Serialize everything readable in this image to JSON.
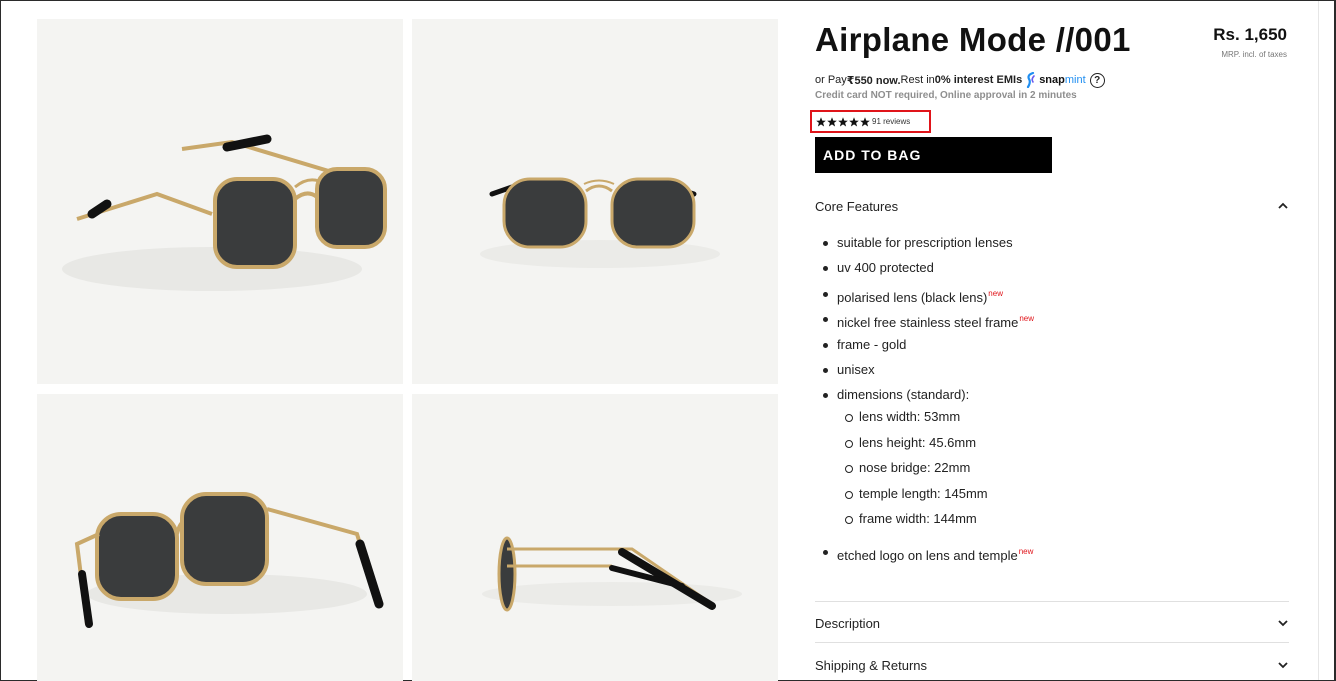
{
  "product": {
    "title": "Airplane Mode //001",
    "price": "Rs. 1,650",
    "price_note": "MRP. incl. of taxes",
    "emi": {
      "prefix": "or Pay ",
      "amount": "₹550 now.",
      "middle": " Rest in ",
      "interest": "0% interest EMIs",
      "brand_part1": "snap",
      "brand_part2": "mint",
      "help": "?",
      "note": "Credit card NOT required, Online approval in 2 minutes"
    },
    "rating": {
      "stars": 5,
      "reviews": "91 reviews"
    },
    "add_to_bag": "ADD TO BAG"
  },
  "gallery": {
    "images": [
      {
        "icon": "sunglasses-three-quarter-view"
      },
      {
        "icon": "sunglasses-front-view"
      },
      {
        "icon": "sunglasses-rear-view"
      },
      {
        "icon": "sunglasses-side-view"
      }
    ]
  },
  "accordion": {
    "core": {
      "label": "Core Features",
      "expanded": true,
      "features": [
        {
          "text": "suitable for prescription lenses",
          "new": ""
        },
        {
          "text": "uv 400 protected",
          "new": ""
        },
        {
          "text": "polarised lens (black lens)",
          "new": "new"
        },
        {
          "text": "nickel free stainless steel frame",
          "new": "new"
        },
        {
          "text": "frame - gold",
          "new": ""
        },
        {
          "text": "unisex",
          "new": ""
        },
        {
          "text": "dimensions (standard):",
          "new": ""
        },
        {
          "text": "etched logo on lens and temple",
          "new": "new"
        }
      ],
      "dimensions": [
        "lens width: 53mm",
        "lens height: 45.6mm",
        "nose bridge: 22mm",
        "temple length: 145mm",
        "frame width: 144mm"
      ]
    },
    "description": {
      "label": "Description",
      "expanded": false
    },
    "shipping": {
      "label": "Shipping & Returns",
      "expanded": false
    }
  },
  "colors": {
    "accent_red": "#e0141a",
    "snapmint_blue": "#1f8ef1",
    "button_bg": "#000000",
    "frame_gold": "#c9a86a",
    "lens_dark": "#3a3c3d"
  }
}
